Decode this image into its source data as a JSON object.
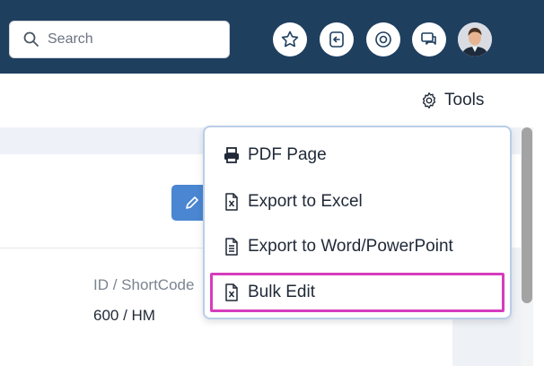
{
  "header": {
    "search": {
      "placeholder": "Search",
      "value": ""
    },
    "icons": [
      "star-icon",
      "sign-out-icon",
      "help-icon",
      "chat-icon"
    ],
    "colors": {
      "bar": "#1f3f5f"
    }
  },
  "toolbar": {
    "tools_label": "Tools"
  },
  "record": {
    "field_label": "ID / ShortCode",
    "field_value": "600 / HM"
  },
  "tools_menu": {
    "items": [
      {
        "label": "PDF Page",
        "icon": "printer-icon"
      },
      {
        "label": "Export to Excel",
        "icon": "excel-file-icon"
      },
      {
        "label": "Export to Word/PowerPoint",
        "icon": "document-icon"
      },
      {
        "label": "Bulk Edit",
        "icon": "excel-file-icon",
        "highlighted": true
      }
    ],
    "highlight_color": "#d63cbc"
  }
}
